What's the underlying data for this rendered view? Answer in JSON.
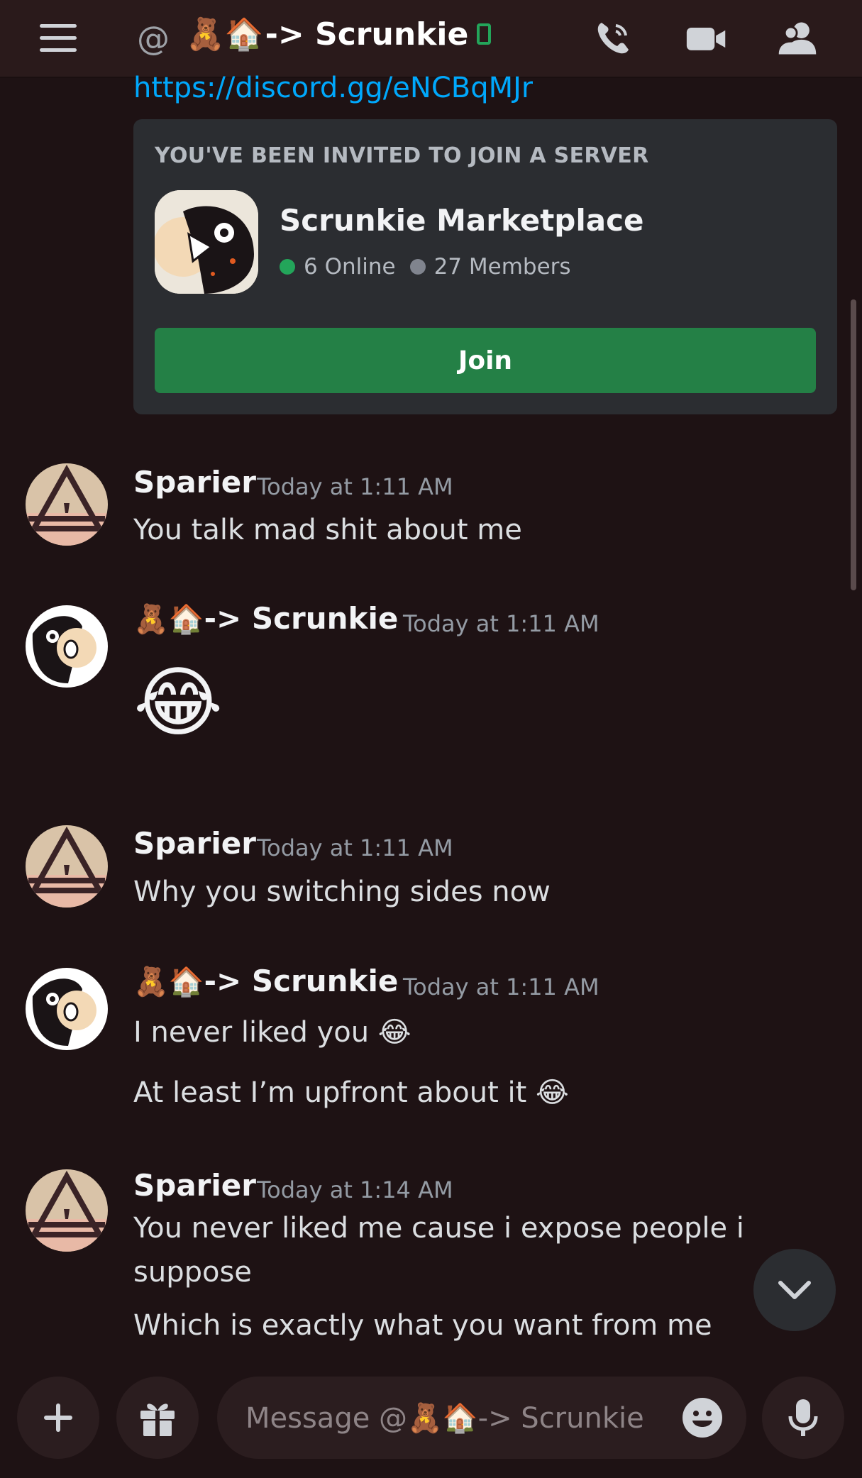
{
  "header": {
    "title_emoji": "🧸🏠",
    "title_text": "-> Scrunkie",
    "icons": [
      "menu-icon",
      "at-icon",
      "mobile-status-icon",
      "phone-call-icon",
      "video-call-icon",
      "member-list-icon"
    ]
  },
  "link": {
    "url": "https://discord.gg/eNCBqMJr"
  },
  "invite": {
    "heading": "YOU'VE BEEN INVITED TO JOIN A SERVER",
    "server_name": "Scrunkie Marketplace",
    "online": "6 Online",
    "members": "27 Members",
    "join_label": "Join"
  },
  "messages": [
    {
      "author": "Sparier",
      "time": "Today at 1:11 AM",
      "lines": [
        "You talk mad shit about me"
      ]
    },
    {
      "author_emoji": "🧸🏠",
      "author": "-> Scrunkie",
      "time": "Today at 1:11 AM",
      "emoji_only": "😂"
    },
    {
      "author": "Sparier",
      "time": "Today at 1:11 AM",
      "lines": [
        "Why you switching sides now"
      ]
    },
    {
      "author_emoji": "🧸🏠",
      "author": "-> Scrunkie",
      "time": "Today at 1:11 AM",
      "lines": [
        "I never liked you 😂",
        "At least I’m upfront about it 😂"
      ]
    },
    {
      "author": "Sparier",
      "time": "Today at 1:14 AM",
      "lines": [
        "You never liked me cause i expose people i suppose",
        "Which is exactly what you want from me"
      ]
    }
  ],
  "composer": {
    "placeholder": "Message @🧸🏠-> Scrunkie"
  },
  "colors": {
    "background": "#1e1214",
    "link": "#00a8fc",
    "join_green": "#248046",
    "online_green": "#23a55a"
  }
}
